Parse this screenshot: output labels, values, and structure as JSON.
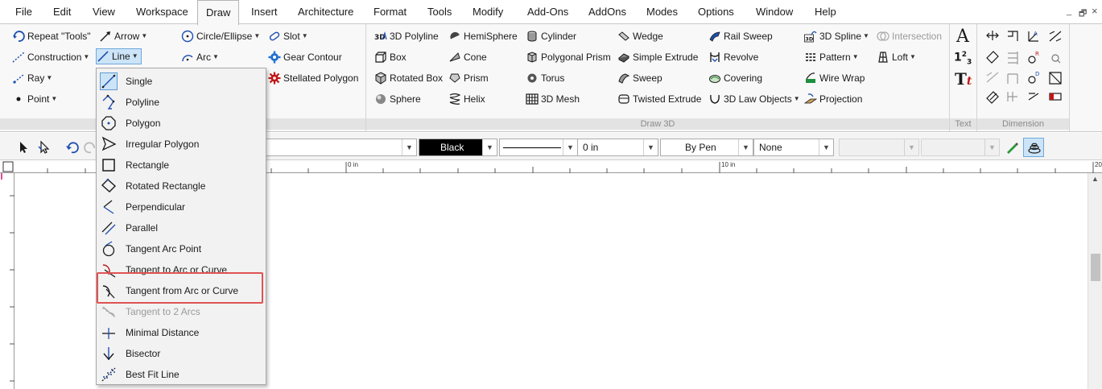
{
  "menubar": {
    "items": [
      "File",
      "Edit",
      "View",
      "Workspace",
      "Draw",
      "Insert",
      "Architecture",
      "Format",
      "Tools",
      "Modify",
      "Add-Ons",
      "AddOns",
      "Modes",
      "Options",
      "Window",
      "Help"
    ],
    "active": "Draw",
    "window_controls": [
      "_",
      "🗗",
      "×"
    ]
  },
  "ribbon": {
    "col1": [
      "Repeat \"Tools\"",
      "Construction",
      "Ray",
      "Point"
    ],
    "col2": [
      "Arrow",
      "Line"
    ],
    "col3": [
      "Circle/Ellipse",
      "Arc"
    ],
    "col4": [
      "Slot",
      "Gear Contour",
      "Stellated Polygon"
    ],
    "draw3d_col1": [
      "3D Polyline",
      "Box",
      "Rotated Box",
      "Sphere"
    ],
    "draw3d_col2": [
      "HemiSphere",
      "Cone",
      "Prism",
      "Helix"
    ],
    "draw3d_col3": [
      "Cylinder",
      "Polygonal Prism",
      "Torus",
      "3D Mesh"
    ],
    "draw3d_col4": [
      "Wedge",
      "Simple Extrude",
      "Sweep",
      "Twisted Extrude"
    ],
    "draw3d_col5": [
      "Rail Sweep",
      "Revolve",
      "Covering",
      "3D Law Objects"
    ],
    "draw3d_col6": [
      "3D Spline",
      "Pattern",
      "Wire Wrap",
      "Projection"
    ],
    "draw3d_col7": [
      "Intersection",
      "Loft"
    ],
    "group_labels": {
      "draw3d": "Draw 3D",
      "text": "Text",
      "dimension": "Dimension"
    }
  },
  "toolbar": {
    "color_value": "Black",
    "linewidth_value": "0 in",
    "linestyle_value": "By Pen",
    "fill_value": "None"
  },
  "ruler": {
    "label_0": "0 in",
    "label_10": "10 in",
    "label_20": "20"
  },
  "dropdown": {
    "items": [
      {
        "label": "Single",
        "icon": "line-single-icon",
        "selected": true,
        "disabled": false
      },
      {
        "label": "Polyline",
        "icon": "polyline-icon",
        "selected": false,
        "disabled": false
      },
      {
        "label": "Polygon",
        "icon": "polygon-icon",
        "selected": false,
        "disabled": false
      },
      {
        "label": "Irregular Polygon",
        "icon": "irregular-polygon-icon",
        "selected": false,
        "disabled": false
      },
      {
        "label": "Rectangle",
        "icon": "rectangle-icon",
        "selected": false,
        "disabled": false
      },
      {
        "label": "Rotated Rectangle",
        "icon": "rotated-rectangle-icon",
        "selected": false,
        "disabled": false
      },
      {
        "label": "Perpendicular",
        "icon": "perpendicular-icon",
        "selected": false,
        "disabled": false
      },
      {
        "label": "Parallel",
        "icon": "parallel-icon",
        "selected": false,
        "disabled": false
      },
      {
        "label": "Tangent Arc Point",
        "icon": "tangent-arc-point-icon",
        "selected": false,
        "disabled": false
      },
      {
        "label": "Tangent to Arc or Curve",
        "icon": "tangent-to-arc-icon",
        "selected": false,
        "disabled": false
      },
      {
        "label": "Tangent from Arc or Curve",
        "icon": "tangent-from-arc-icon",
        "selected": false,
        "disabled": false
      },
      {
        "label": "Tangent to 2 Arcs",
        "icon": "tangent-two-arcs-icon",
        "selected": false,
        "disabled": true
      },
      {
        "label": "Minimal Distance",
        "icon": "minimal-distance-icon",
        "selected": false,
        "disabled": false
      },
      {
        "label": "Bisector",
        "icon": "bisector-icon",
        "selected": false,
        "disabled": false
      },
      {
        "label": "Best Fit Line",
        "icon": "best-fit-line-icon",
        "selected": false,
        "disabled": false
      }
    ],
    "highlighted": "Tangent from Arc or Curve"
  },
  "colors": {
    "accent": "#cce4f7",
    "highlight": "#e05353",
    "icon_blue": "#1f4fb0",
    "icon_red": "#c01818"
  }
}
